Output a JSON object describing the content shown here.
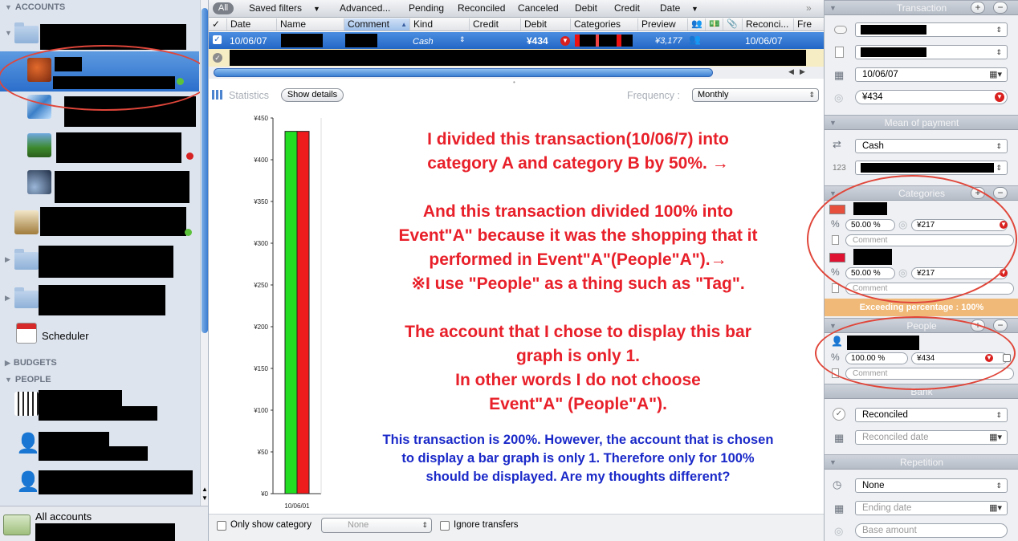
{
  "sidebar": {
    "accounts_header": "ACCOUNTS",
    "budgets_header": "BUDGETS",
    "people_header": "PEOPLE",
    "scheduler_label": "Scheduler",
    "all_accounts_label": "All accounts"
  },
  "filterbar": {
    "all": "All",
    "saved_filters": "Saved filters",
    "advanced": "Advanced...",
    "pending": "Pending",
    "reconciled": "Reconciled",
    "canceled": "Canceled",
    "debit": "Debit",
    "credit": "Credit",
    "date": "Date"
  },
  "columns": {
    "check": "✓",
    "date": "Date",
    "name": "Name",
    "comment": "Comment",
    "kind": "Kind",
    "credit": "Credit",
    "debit": "Debit",
    "categories": "Categories",
    "preview": "Preview",
    "reconci": "Reconci...",
    "fre": "Fre"
  },
  "transaction_row": {
    "date": "10/06/07",
    "kind": "Cash",
    "debit": "¥434",
    "preview": "¥3,177",
    "reconciled_date": "10/06/07"
  },
  "stats": {
    "title": "Statistics",
    "show_details": "Show details",
    "frequency_label": "Frequency :",
    "frequency_value": "Monthly"
  },
  "chart_data": {
    "type": "bar",
    "categories": [
      "10/06/01"
    ],
    "series": [
      {
        "values": [
          434
        ],
        "color": "#22dd22"
      },
      {
        "values": [
          434
        ],
        "color": "#ee1c1c"
      }
    ],
    "y_ticks": [
      "¥0",
      "¥50",
      "¥100",
      "¥150",
      "¥200",
      "¥250",
      "¥300",
      "¥350",
      "¥400",
      "¥450"
    ],
    "ylim": [
      0,
      450
    ],
    "y_tick_step": 50,
    "grid": false
  },
  "annotations": {
    "red": [
      "I divided this transaction(10/06/7) into",
      "category A and category B by 50%. →",
      "",
      "And this transaction divided 100% into",
      "Event\"A\" because it was the shopping that it",
      "performed in Event\"A\"(People\"A\").→",
      "※I use \"People\" as a thing such as \"Tag\".",
      "",
      "The account that I chose to display this bar",
      "graph is only 1.",
      "In other words I do not choose",
      "Event\"A\"  (People\"A\")."
    ],
    "blue": [
      "This transaction is 200%. However, the account that is chosen",
      "to display a bar graph is only 1. Therefore only for 100%",
      "should be displayed. Are my thoughts different?"
    ]
  },
  "bottombar": {
    "only_show_category": "Only show category",
    "none_select": "None",
    "ignore_transfers": "Ignore transfers"
  },
  "inspector": {
    "transaction_header": "Transaction",
    "date_value": "10/06/07",
    "amount_value": "¥434",
    "mean_header": "Mean of payment",
    "payment_value": "Cash",
    "number_icon": "123",
    "categories_header": "Categories",
    "cat1_percent": "50.00 %",
    "cat1_amount": "¥217",
    "cat2_percent": "50.00 %",
    "cat2_amount": "¥217",
    "comment_placeholder": "Comment",
    "exceeding": "Exceeding percentage : 100%",
    "people_header": "People",
    "people_percent": "100.00 %",
    "people_amount": "¥434",
    "bank_header": "Bank",
    "bank_status": "Reconciled",
    "reconciled_date_placeholder": "Reconciled date",
    "repetition_header": "Repetition",
    "repetition_value": "None",
    "ending_date_placeholder": "Ending date",
    "base_amount_placeholder": "Base amount",
    "plus": "+",
    "minus": "−"
  },
  "colors": {
    "accent_blue": "#2c6fcc",
    "annotation_red": "#e8202a",
    "annotation_blue": "#1a29c8",
    "oval_red": "#e0463a",
    "exceeding_bg": "#f0b977"
  }
}
